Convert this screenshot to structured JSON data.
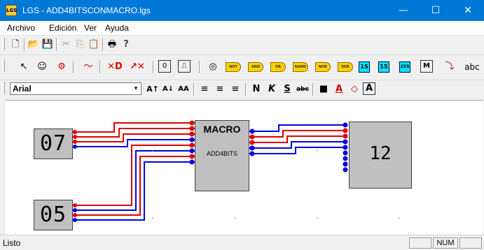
{
  "window": {
    "title": "LGS - ADD4BITSCONMACRO.lgs",
    "icon_label": "LGS",
    "minimize": "—",
    "maximize": "☐",
    "close": "✕"
  },
  "menu": [
    "Archivo",
    "Edición",
    "Ver",
    "Ayuda"
  ],
  "toolbar_std": {
    "icons": [
      "new-icon",
      "open-icon",
      "save-icon",
      "cut-icon",
      "copy-icon",
      "paste-icon",
      "print-icon",
      "help-icon"
    ],
    "glyphs": [
      "🗋",
      "📂",
      "💾",
      "✂",
      "⎘",
      "📋",
      "🖶",
      "?"
    ]
  },
  "toolbar_tools": {
    "glyphs": [
      "↖",
      "☺",
      "⚙",
      "〜",
      "✕D",
      "↗✕",
      "0",
      "⎍",
      "◎"
    ],
    "gates": [
      "NOT",
      "AND",
      "OR",
      "NAND",
      "NOR",
      "XOR"
    ],
    "displays": [
      "15",
      "15",
      "255"
    ],
    "macro_btn": "M",
    "text_btn": "abc"
  },
  "toolbar_format": {
    "font": "Arial",
    "dropdown": "▾",
    "buttons": [
      "A↑",
      "A↓",
      "AA",
      "≡",
      "≡",
      "≡",
      "N",
      "K",
      "S",
      "abc",
      "■",
      "A",
      "◇",
      "A"
    ]
  },
  "canvas": {
    "display_top_value": "07",
    "display_bottom_value": "05",
    "macro_title": "MACRO",
    "macro_subtitle": "ADD4BITS",
    "output_value": "12",
    "colors": {
      "red_wire": "#e00000",
      "blue_wire": "#0000e0",
      "component_bg": "#c0c0c0"
    }
  },
  "status": {
    "text": "Listo",
    "num": "NUM"
  }
}
